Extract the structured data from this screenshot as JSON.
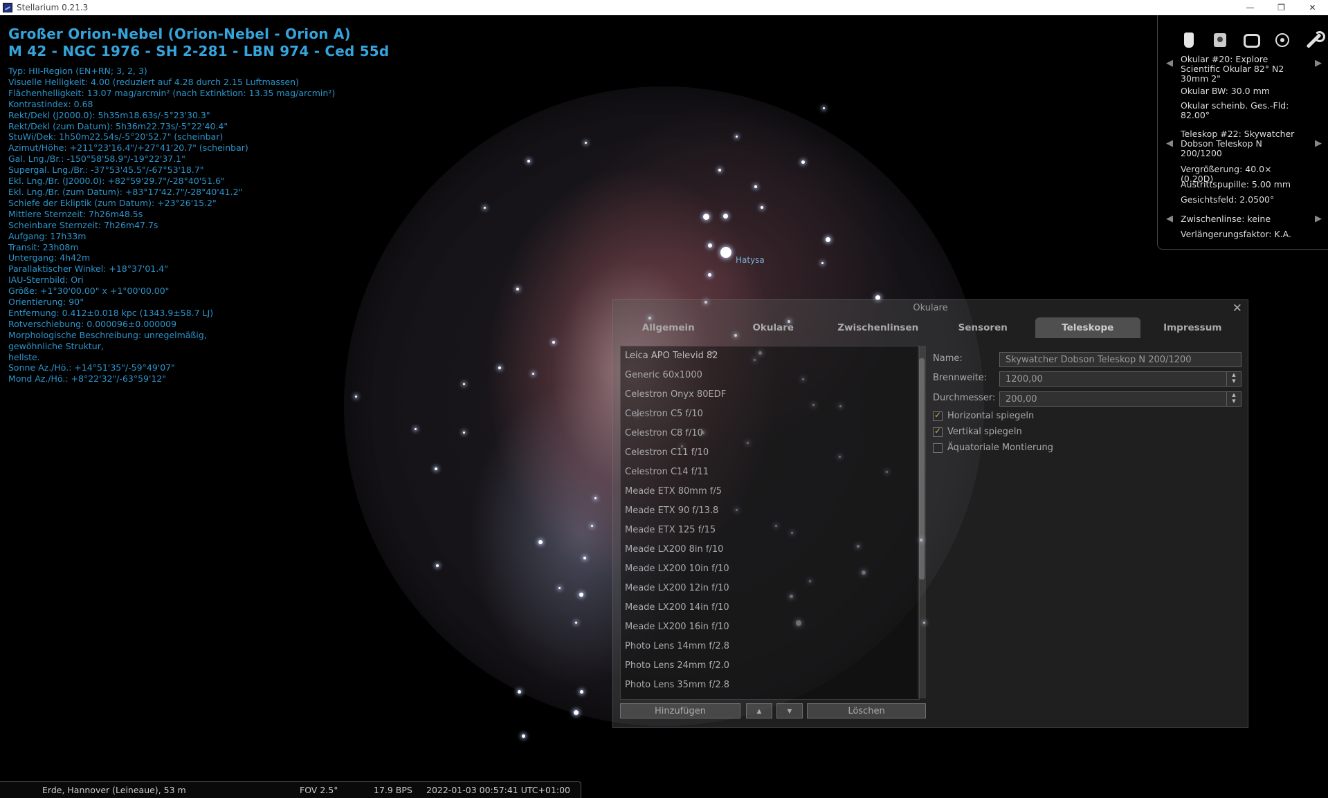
{
  "window": {
    "title": "Stellarium 0.21.3"
  },
  "object_info": {
    "title_line1": "Großer Orion-Nebel (Orion-Nebel - Orion A)",
    "title_line2": "M 42 - NGC 1976 - SH 2-281 - LBN 974 - Ced 55d",
    "lines": [
      "Typ: HII-Region (EN+RN; 3, 2, 3)",
      "Visuelle Helligkeit: 4.00 (reduziert auf 4.28 durch 2.15 Luftmassen)",
      "Flächenhelligkeit: 13.07 mag/arcmin² (nach Extinktion: 13.35 mag/arcmin²)",
      "Kontrastindex: 0.68",
      "Rekt/Dekl (J2000.0): 5h35m18.63s/-5°23'30.3\"",
      "Rekt/Dekl (zum Datum): 5h36m22.73s/-5°22'40.4\"",
      "StuWi/Dek: 1h50m22.54s/-5°20'52.7\" (scheinbar)",
      "Azimut/Höhe: +211°23'16.4\"/+27°41'20.7\" (scheinbar)",
      "Gal. Lng./Br.: -150°58'58.9\"/-19°22'37.1\"",
      "Supergal. Lng./Br.: -37°53'45.5\"/-67°53'18.7\"",
      "Ekl. Lng./Br. (J2000.0): +82°59'29.7\"/-28°40'51.6\"",
      "Ekl. Lng./Br. (zum Datum): +83°17'42.7\"/-28°40'41.2\"",
      "Schiefe der Ekliptik (zum Datum): +23°26'15.2\"",
      "Mittlere Sternzeit: 7h26m48.5s",
      "Scheinbare Sternzeit: 7h26m47.7s",
      "Aufgang: 17h33m",
      "Transit: 23h08m",
      "Untergang: 4h42m",
      "Parallaktischer Winkel: +18°37'01.4\"",
      "IAU-Sternbild: Ori",
      "Größe: +1°30'00.00\" x +1°00'00.00\"",
      "Orientierung: 90°",
      "Entfernung: 0.412±0.018 kpc (1343.9±58.7 LJ)",
      "Rotverschiebung: 0.000096±0.000009",
      "Morphologische Beschreibung: unregelmäßig,",
      "gewöhnliche Struktur,",
      "hellste.",
      "Sonne Az./Hö.: +14°51'35\"/-59°49'07\"",
      "Mond Az./Hö.: +8°22'32\"/-63°59'12\""
    ]
  },
  "sky": {
    "star_label": "Hatysa"
  },
  "ocular_panel": {
    "icons": [
      "eyepiece-icon",
      "sensor-icon",
      "frame-icon",
      "target-icon",
      "wrench-icon"
    ],
    "ocular_name": "Okular #20: Explore Scientific Okular 82° N2 30mm 2\"",
    "ocular_fl": "Okular BW: 30.0 mm",
    "ocular_afov": "Okular scheinb. Ges.-Fld: 82.00°",
    "telescope_name": "Teleskop #22: Skywatcher Dobson Teleskop N 200/1200",
    "magnification": "Vergrößerung: 40.0× (0.20D)",
    "exit_pupil": "Austrittspupille: 5.00 mm",
    "fov": "Gesichtsfeld: 2.0500°",
    "lens": "Zwischenlinse: keine",
    "extension": "Verlängerungsfaktor: K.A."
  },
  "dialog": {
    "title": "Okulare",
    "tabs": [
      "Allgemein",
      "Okulare",
      "Zwischenlinsen",
      "Sensoren",
      "Teleskope",
      "Impressum"
    ],
    "active_tab": "Teleskope",
    "telescopes": [
      "Leica APO Televid 82",
      "Generic 60x1000",
      "Celestron Onyx 80EDF",
      "Celestron C5 f/10",
      "Celestron C8 f/10",
      "Celestron C11 f/10",
      "Celestron C14 f/11",
      "Meade ETX 80mm f/5",
      "Meade ETX 90 f/13.8",
      "Meade ETX 125 f/15",
      "Meade LX200 8in f/10",
      "Meade  LX200 10in f/10",
      "Meade  LX200 12in f/10",
      "Meade  LX200 14in f/10",
      "Meade  LX200 16in f/10",
      "Photo Lens 14mm f/2.8",
      "Photo Lens 24mm f/2.0",
      "Photo Lens 35mm f/2.8"
    ],
    "name_label": "Name:",
    "name_value": "Skywatcher Dobson Teleskop N 200/1200",
    "focal_label": "Brennweite:",
    "focal_value": "1200,00",
    "diameter_label": "Durchmesser:",
    "diameter_value": "200,00",
    "chk_hflip": "Horizontal spiegeln",
    "chk_vflip": "Vertikal spiegeln",
    "chk_eq": "Äquatoriale Montierung",
    "btn_add": "Hinzufügen",
    "btn_up": "▲",
    "btn_down": "▼",
    "btn_delete": "Löschen"
  },
  "statusbar": {
    "location": "Erde, Hannover (Leineaue), 53 m",
    "fov": "FOV 2.5°",
    "fps": "17.9 BPS",
    "datetime": "2022-01-03 00:57:41 UTC+01:00"
  }
}
